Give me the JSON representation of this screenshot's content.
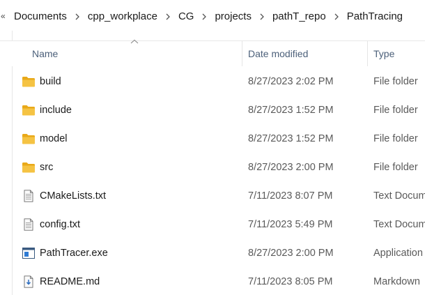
{
  "breadcrumb": {
    "overflow": "«",
    "items": [
      "Documents",
      "cpp_workplace",
      "CG",
      "projects",
      "pathT_repo",
      "PathTracing"
    ]
  },
  "columns": {
    "name": "Name",
    "date_modified": "Date modified",
    "type": "Type",
    "sort": "name-ascending"
  },
  "files": [
    {
      "name": "build",
      "date": "8/27/2023 2:02 PM",
      "type": "File folder",
      "icon": "folder-icon"
    },
    {
      "name": "include",
      "date": "8/27/2023 1:52 PM",
      "type": "File folder",
      "icon": "folder-icon"
    },
    {
      "name": "model",
      "date": "8/27/2023 1:52 PM",
      "type": "File folder",
      "icon": "folder-icon"
    },
    {
      "name": "src",
      "date": "8/27/2023 2:00 PM",
      "type": "File folder",
      "icon": "folder-icon"
    },
    {
      "name": "CMakeLists.txt",
      "date": "7/11/2023 8:07 PM",
      "type": "Text Docum",
      "icon": "text-file-icon"
    },
    {
      "name": "config.txt",
      "date": "7/11/2023 5:49 PM",
      "type": "Text Docum",
      "icon": "text-file-icon"
    },
    {
      "name": "PathTracer.exe",
      "date": "8/27/2023 2:00 PM",
      "type": "Application",
      "icon": "exe-file-icon"
    },
    {
      "name": "README.md",
      "date": "7/11/2023 8:05 PM",
      "type": "Markdown",
      "icon": "markdown-file-icon"
    }
  ],
  "colors": {
    "folder": "#f5c343",
    "header_text": "#4c607a",
    "meta_text": "#5a5a5a"
  }
}
